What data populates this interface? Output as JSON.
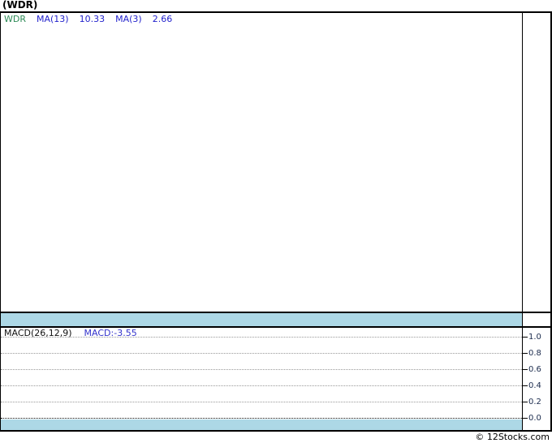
{
  "title": "(WDR)",
  "main_chart": {
    "legend": {
      "symbol": "WDR",
      "ma13_label": "MA(13)",
      "ma13_value": "10.33",
      "ma3_label": "MA(3)",
      "ma3_value": "2.66"
    }
  },
  "macd_panel": {
    "label": "MACD(26,12,9)",
    "value_label": "MACD:-3.55",
    "axis_ticks": [
      "1.0",
      "0.8",
      "0.6",
      "0.4",
      "0.2",
      "0.0"
    ]
  },
  "footer": {
    "copyright": "© 12Stocks.com"
  },
  "colors": {
    "symbol_green": "#2E8B57",
    "indicator_blue": "#2222CC",
    "macd_value_blue": "#3333CC",
    "axis_label_navy": "#1A2A4C",
    "band_light_blue": "#ADD8E6",
    "border_black": "#000000",
    "grid_gray": "#999999"
  },
  "chart_data": [
    {
      "type": "line",
      "title": "(WDR) price panel",
      "series": [
        {
          "name": "WDR",
          "values": []
        },
        {
          "name": "MA(13)",
          "last_value": 10.33,
          "values": []
        },
        {
          "name": "MA(3)",
          "last_value": 2.66,
          "values": []
        }
      ],
      "note": "plot area is empty (no candles/lines drawn); light-blue date-axis band at bottom with no date labels",
      "legend_position": "top-left",
      "grid": "off"
    },
    {
      "type": "line",
      "title": "MACD(26,12,9)",
      "series": [
        {
          "name": "MACD",
          "last_value": -3.55,
          "values": []
        }
      ],
      "ylim": [
        0.0,
        1.0
      ],
      "yticks": [
        1.0,
        0.8,
        0.6,
        0.4,
        0.2,
        0.0
      ],
      "ylabel": "",
      "xlabel": "",
      "grid": "horizontal dotted lines at each ytick, zero line darker",
      "legend_position": "top-left",
      "note": "no MACD curve plotted; light-blue band below the 0.0 line"
    }
  ]
}
